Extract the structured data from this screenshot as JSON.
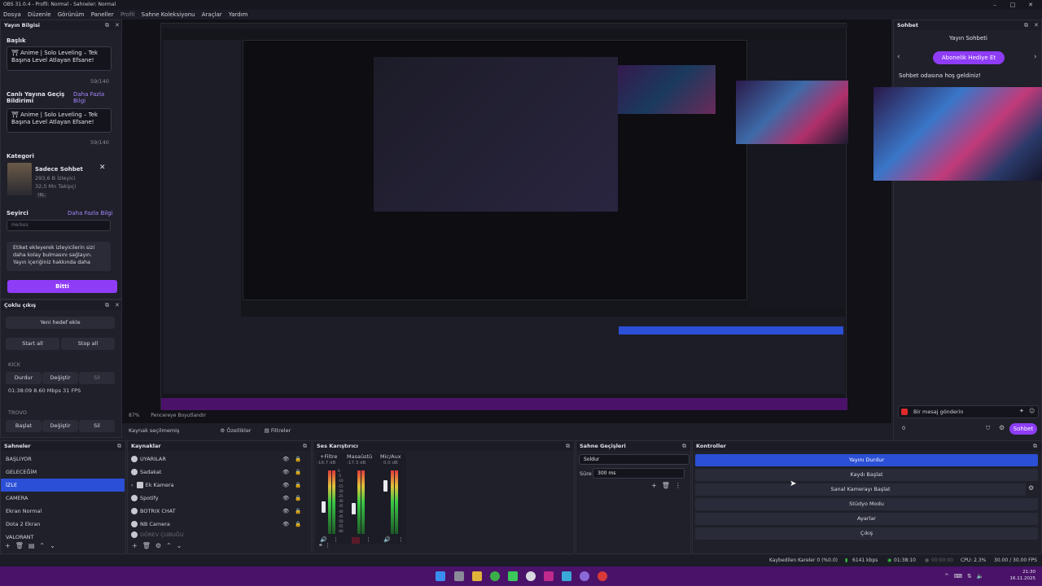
{
  "window": {
    "title": "OBS 31.0.4 - Profil: Normal - Sahneler: Normal"
  },
  "menu": [
    "Dosya",
    "Düzenle",
    "Görünüm",
    "Paneller",
    "Profil",
    "Sahne Koleksiyonu",
    "Araçlar",
    "Yardım"
  ],
  "stream_info": {
    "header": "Yayın Bilgisi",
    "title_label": "Başlık",
    "title_value": "⛩ Anime | Solo Leveling – Tek Başına Level Atlayan Efsane!",
    "title_count": "59/140",
    "live_label": "Canlı Yayına Geçiş Bildirimi",
    "live_link": "Daha Fazla Bilgi",
    "live_value": "⛩ Anime | Solo Leveling – Tek Başına Level Atlayan Efsane!",
    "live_count": "59/140",
    "category_label": "Kategori",
    "category_name": "Sadece Sohbet",
    "category_viewers": "293,6 B İzleyici",
    "category_followers": "32,5 Mn Takipçi",
    "category_tag": "IRL",
    "audience_label": "Seyirci",
    "audience_link": "Daha Fazla Bilgi",
    "audience_value": "Herkes",
    "tags_tip": "Etiket ekleyerek izleyicilerin sizi daha kolay bulmasını sağlayın. Yayın içeriğiniz hakkında daha",
    "done_button": "Bitti"
  },
  "multistream": {
    "header": "Çoklu çıkış",
    "add_target": "Yeni hedef ekle",
    "start_all": "Start all",
    "stop_all": "Stop all",
    "kick_label": "KICK",
    "kick_stop": "Durdur",
    "kick_change": "Değiştir",
    "kick_delete": "Sil",
    "kick_stats": "01:38:09  8.60 Mbps  31 FPS",
    "trovo_label": "TROVO",
    "trovo_start": "Başlat",
    "trovo_change": "Değiştir",
    "trovo_delete": "Sil"
  },
  "chat": {
    "header": "Sohbet",
    "title": "Yayın Sohbeti",
    "gift_button": "Abonelik Hediye Et",
    "welcome": "Sohbet odasına hoş geldiniz!",
    "input_placeholder": "Bir mesaj gönderin",
    "send_button": "Sohbet",
    "count": "0"
  },
  "preview_bar": {
    "zoom": "87%",
    "mode": "Pencereye Boyutlandır"
  },
  "source_bar": {
    "selected": "Kaynak seçilmemiş",
    "props": "Özellikler",
    "filters": "Filtreler"
  },
  "scenes": {
    "header": "Sahneler",
    "items": [
      "BAŞLIYOR",
      "GELECEĞİM",
      "İZLE",
      "CAMERA",
      "Ekran Normal",
      "Dota 2 Ekran",
      "VALORANT"
    ],
    "active": "İZLE"
  },
  "sources": {
    "header": "Kaynaklar",
    "items": [
      "UYARILAR",
      "Sadakat",
      "Ek Kamera",
      "Spotify",
      "BOTRIX CHAT",
      "NB Camera",
      "GÖREV ÇUBUĞU"
    ]
  },
  "mixer": {
    "header": "Ses Karıştırıcı",
    "channels": [
      {
        "name": "+Filtre",
        "db": "-16.7 dB"
      },
      {
        "name": "Masaüstü",
        "db": "-17.3 dB"
      },
      {
        "name": "Mic/Aux",
        "db": "0.0 dB"
      }
    ],
    "scale": [
      "0",
      "-5",
      "-10",
      "-15",
      "-20",
      "-25",
      "-30",
      "-35",
      "-40",
      "-45",
      "-50",
      "-55",
      "-60"
    ]
  },
  "transitions": {
    "header": "Sahne Geçişleri",
    "type": "Soldur",
    "duration_label": "Süre",
    "duration_value": "300 ms"
  },
  "controls": {
    "header": "Kontroller",
    "buttons": [
      "Yayını Durdur",
      "Kaydı Başlat",
      "Sanal Kamerayı Başlat",
      "Stüdyo Modu",
      "Ayarlar",
      "Çıkış"
    ]
  },
  "status": {
    "dropped": "Kaybedilen Kareler 0 (%0.0)",
    "bitrate": "6141 kbps",
    "stream_time": "01:38:10",
    "rec_time": "00:00:00",
    "cpu": "CPU: 2.3%",
    "fps": "30.00 / 30.00 FPS"
  },
  "taskbar": {
    "time": "21:30",
    "date": "16.11.2025"
  },
  "colors": {
    "accent": "#8e3cf6",
    "active_control": "#2b4fd6",
    "taskbar": "#4a1269"
  }
}
